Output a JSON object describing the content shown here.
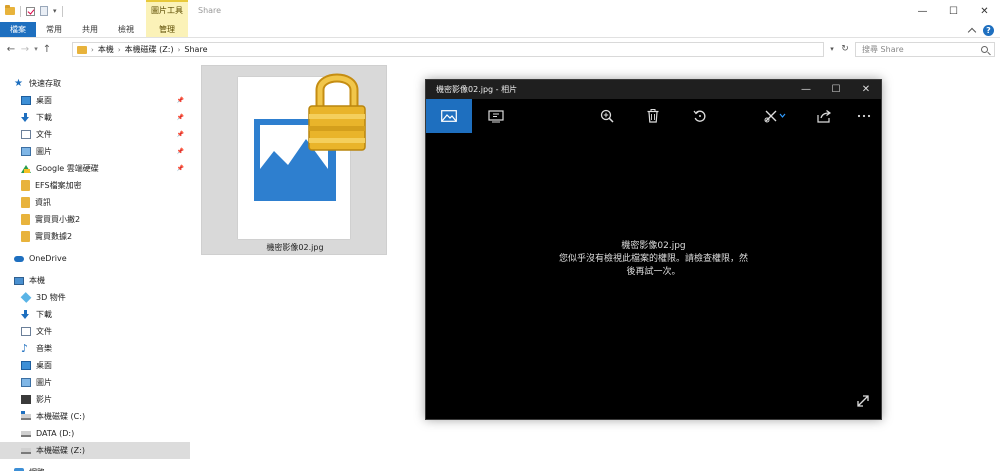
{
  "explorer": {
    "title": "Share",
    "contextual_tab_group": "圖片工具",
    "window_controls": {
      "minimize": "—",
      "maximize": "☐",
      "close": "✕"
    },
    "ribbon_tabs": [
      "檔案",
      "常用",
      "共用",
      "檢視"
    ],
    "manage_tab": "管理",
    "address": {
      "segments": [
        "本機",
        "本機磁碟 (Z:)",
        "Share"
      ]
    },
    "search": {
      "placeholder": "搜尋 Share"
    }
  },
  "nav": [
    {
      "label": "快速存取",
      "icon": "star-icon",
      "indent": 0,
      "pinned": false
    },
    {
      "label": "桌面",
      "icon": "desktop-icon",
      "indent": 1,
      "pinned": true
    },
    {
      "label": "下載",
      "icon": "download-icon",
      "indent": 1,
      "pinned": true
    },
    {
      "label": "文件",
      "icon": "documents-icon",
      "indent": 1,
      "pinned": true
    },
    {
      "label": "圖片",
      "icon": "pictures-icon",
      "indent": 1,
      "pinned": true
    },
    {
      "label": "Google 雲端硬碟",
      "icon": "google-drive-icon",
      "indent": 1,
      "pinned": true
    },
    {
      "label": "EFS檔案加密",
      "icon": "folder-icon",
      "indent": 1,
      "pinned": false
    },
    {
      "label": "資訊",
      "icon": "folder-icon",
      "indent": 1,
      "pinned": false
    },
    {
      "label": "實買買小撇2",
      "icon": "folder-icon",
      "indent": 1,
      "pinned": false
    },
    {
      "label": "實買數據2",
      "icon": "folder-icon",
      "indent": 1,
      "pinned": false
    },
    {
      "label": "OneDrive",
      "icon": "onedrive-icon",
      "indent": 0,
      "pinned": false
    },
    {
      "label": "本機",
      "icon": "this-pc-icon",
      "indent": 0,
      "pinned": false
    },
    {
      "label": "3D 物件",
      "icon": "3d-objects-icon",
      "indent": 1,
      "pinned": false
    },
    {
      "label": "下載",
      "icon": "download-icon",
      "indent": 1,
      "pinned": false
    },
    {
      "label": "文件",
      "icon": "documents-icon",
      "indent": 1,
      "pinned": false
    },
    {
      "label": "音樂",
      "icon": "music-icon",
      "indent": 1,
      "pinned": false
    },
    {
      "label": "桌面",
      "icon": "desktop-icon",
      "indent": 1,
      "pinned": false
    },
    {
      "label": "圖片",
      "icon": "pictures-icon",
      "indent": 1,
      "pinned": false
    },
    {
      "label": "影片",
      "icon": "videos-icon",
      "indent": 1,
      "pinned": false
    },
    {
      "label": "本機磁碟 (C:)",
      "icon": "drive-c-icon",
      "indent": 1,
      "pinned": false
    },
    {
      "label": "DATA (D:)",
      "icon": "drive-icon",
      "indent": 1,
      "pinned": false
    },
    {
      "label": "本機磁碟 (Z:)",
      "icon": "drive-icon",
      "indent": 1,
      "pinned": false,
      "selected": true
    },
    {
      "label": "網路",
      "icon": "network-icon",
      "indent": 0,
      "pinned": false
    }
  ],
  "file": {
    "name": "機密影像02.jpg"
  },
  "photos": {
    "title": "機密影像02.jpg - 相片",
    "message": {
      "line1": "機密影像02.jpg",
      "line2": "您似乎沒有檢視此檔案的權限。請檢查權限，然",
      "line3": "後再試一次。"
    },
    "toolbar": [
      "image-view-icon",
      "slideshow-icon",
      "zoom-icon",
      "delete-icon",
      "rotate-icon",
      "edit-icon",
      "share-icon",
      "more-icon"
    ]
  },
  "colors": {
    "accent": "#1e6fbf",
    "contextual": "#fbf2b8",
    "lock_gold": "#e9b42a"
  }
}
